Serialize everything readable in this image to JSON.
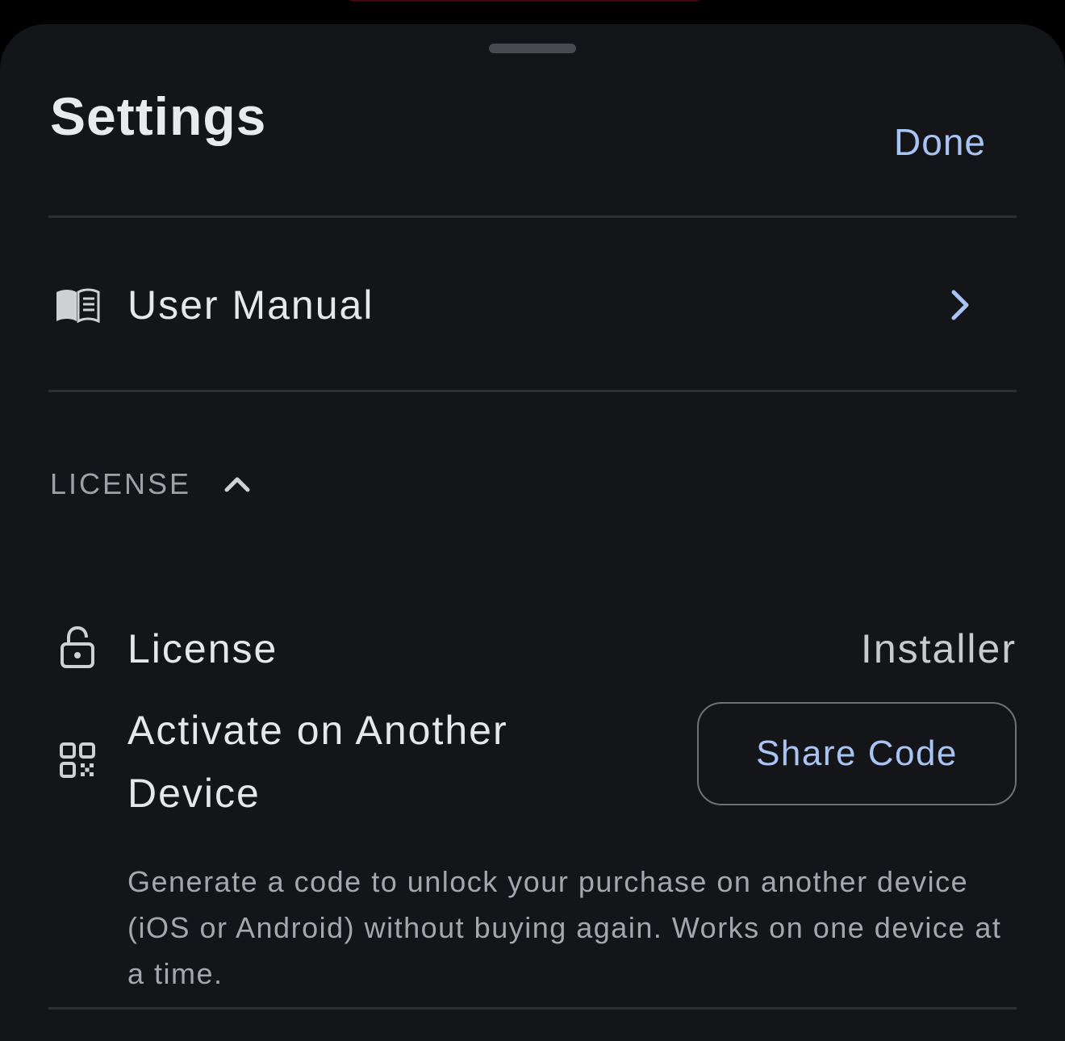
{
  "header": {
    "title": "Settings",
    "done_label": "Done"
  },
  "items": {
    "user_manual": {
      "label": "User Manual",
      "icon": "book-icon"
    }
  },
  "license_section": {
    "header": "LICENSE",
    "expanded": true,
    "license_row": {
      "label": "License",
      "value": "Installer",
      "icon": "lock-icon"
    },
    "activate_row": {
      "label": "Activate on Another Device",
      "button_label": "Share Code",
      "icon": "qr-code-icon",
      "description": "Generate a code to unlock your purchase on another device (iOS or Android) without buying again. Works on one device at a time."
    }
  },
  "colors": {
    "background": "#141519",
    "accent": "#a9c3f3",
    "text_primary": "#e6e7eb",
    "text_secondary": "#a5a7ad",
    "divider": "#2f3035"
  }
}
